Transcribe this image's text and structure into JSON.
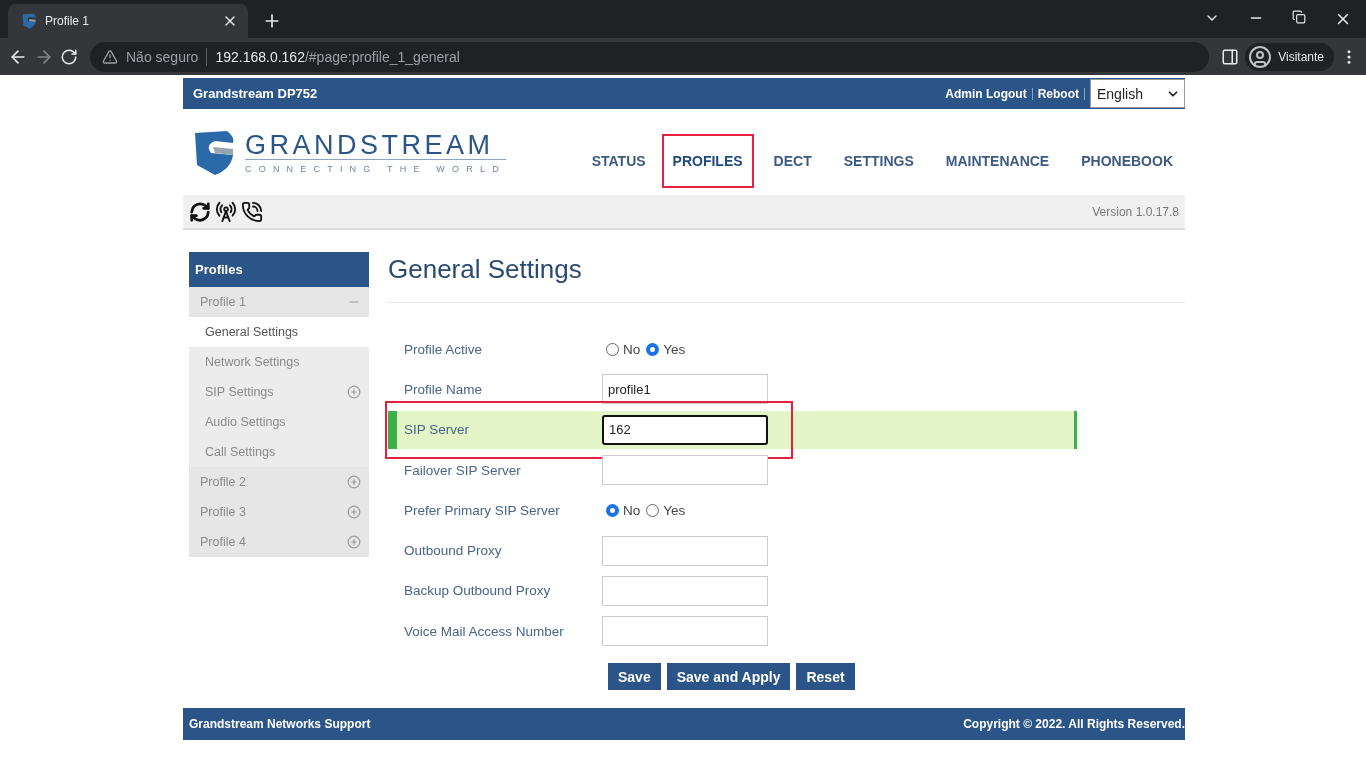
{
  "browser": {
    "tab": {
      "title": "Profile 1"
    },
    "address": {
      "warning": "Não seguro",
      "host": "192.168.0.162",
      "path": "/#page:profile_1_general"
    },
    "profile": "Visitante"
  },
  "topbar": {
    "title": "Grandstream DP752",
    "links": [
      "Admin Logout",
      "Reboot"
    ],
    "language": "English"
  },
  "logo": {
    "name": "GRANDSTREAM",
    "tagline": "CONNECTING THE WORLD"
  },
  "nav": [
    {
      "label": "STATUS",
      "selected": false,
      "annotated": false
    },
    {
      "label": "PROFILES",
      "selected": true,
      "annotated": true
    },
    {
      "label": "DECT",
      "selected": false,
      "annotated": false
    },
    {
      "label": "SETTINGS",
      "selected": false,
      "annotated": false
    },
    {
      "label": "MAINTENANCE",
      "selected": false,
      "annotated": false
    },
    {
      "label": "PHONEBOOK",
      "selected": false,
      "annotated": false
    }
  ],
  "version": "Version 1.0.17.8",
  "sidebar": {
    "title": "Profiles",
    "groups": [
      {
        "label": "Profile 1",
        "expanded": true,
        "children": [
          {
            "label": "General Settings",
            "kind": "link",
            "selected": true
          },
          {
            "label": "Network Settings",
            "kind": "link",
            "selected": false
          },
          {
            "label": "SIP Settings",
            "kind": "group",
            "selected": false
          },
          {
            "label": "Audio Settings",
            "kind": "link",
            "selected": false
          },
          {
            "label": "Call Settings",
            "kind": "link",
            "selected": false
          }
        ]
      },
      {
        "label": "Profile 2",
        "expanded": false
      },
      {
        "label": "Profile 3",
        "expanded": false
      },
      {
        "label": "Profile 4",
        "expanded": false
      }
    ]
  },
  "page_title": "General Settings",
  "form": [
    {
      "label": "Profile Active",
      "kind": "radio",
      "focused": false,
      "annotated": false,
      "options": [
        {
          "label": "No",
          "selected": false
        },
        {
          "label": "Yes",
          "selected": true
        }
      ]
    },
    {
      "label": "Profile Name",
      "kind": "text",
      "value": "profile1",
      "focused": false,
      "annotated": false
    },
    {
      "label": "SIP Server",
      "kind": "text",
      "value": "162",
      "focused": true,
      "annotated": true
    },
    {
      "label": "Failover SIP Server",
      "kind": "text",
      "focused": false,
      "annotated": false
    },
    {
      "label": "Prefer Primary SIP Server",
      "kind": "radio",
      "focused": false,
      "annotated": false,
      "options": [
        {
          "label": "No",
          "selected": true
        },
        {
          "label": "Yes",
          "selected": false
        }
      ]
    },
    {
      "label": "Outbound Proxy",
      "kind": "text",
      "focused": false,
      "annotated": false
    },
    {
      "label": "Backup Outbound Proxy",
      "kind": "text",
      "focused": false,
      "annotated": false
    },
    {
      "label": "Voice Mail Access Number",
      "kind": "text",
      "focused": false,
      "annotated": false
    }
  ],
  "buttons": [
    "Save",
    "Save and Apply",
    "Reset"
  ],
  "footer": {
    "left": "Grandstream Networks Support",
    "right": "Copyright © 2022. All Rights Reserved."
  }
}
